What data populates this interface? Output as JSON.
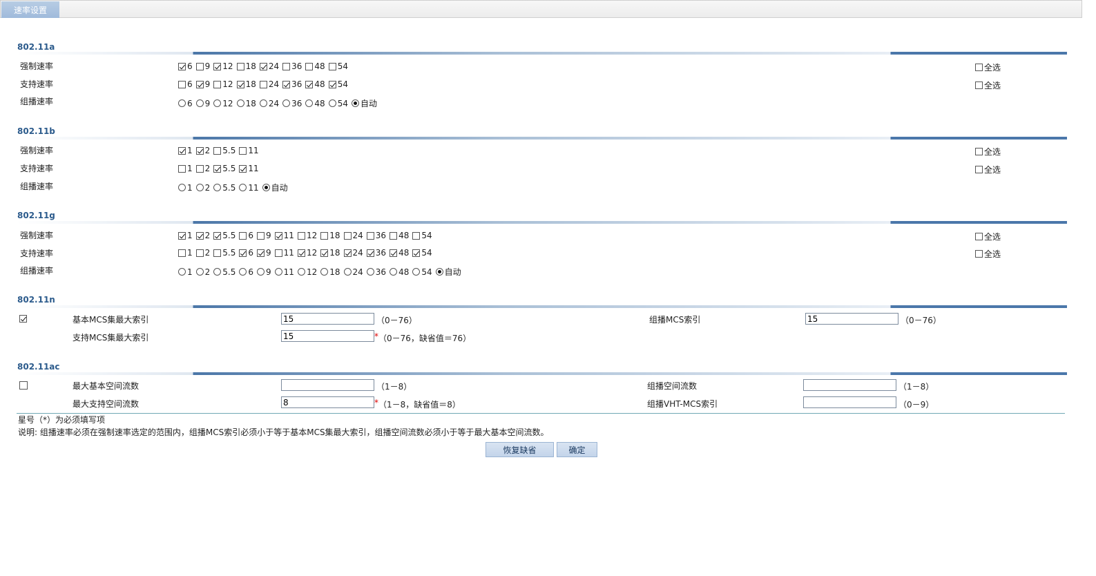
{
  "tab": {
    "label": "速率设置"
  },
  "common": {
    "mandatory": "强制速率",
    "supported": "支持速率",
    "multicast": "组播速率",
    "select_all": "全选",
    "auto": "自动"
  },
  "a": {
    "title": "802.11a",
    "rates": [
      "6",
      "9",
      "12",
      "18",
      "24",
      "36",
      "48",
      "54"
    ],
    "mandatory_checked": [
      true,
      false,
      true,
      false,
      true,
      false,
      false,
      false
    ],
    "supported_checked": [
      false,
      true,
      false,
      true,
      false,
      true,
      true,
      true
    ],
    "multicast_selected": "自动"
  },
  "b": {
    "title": "802.11b",
    "rates": [
      "1",
      "2",
      "5.5",
      "11"
    ],
    "mandatory_checked": [
      true,
      true,
      false,
      false
    ],
    "supported_checked": [
      false,
      false,
      true,
      true
    ],
    "multicast_selected": "自动"
  },
  "g": {
    "title": "802.11g",
    "rates": [
      "1",
      "2",
      "5.5",
      "6",
      "9",
      "11",
      "12",
      "18",
      "24",
      "36",
      "48",
      "54"
    ],
    "mandatory_checked": [
      true,
      true,
      true,
      false,
      false,
      true,
      false,
      false,
      false,
      false,
      false,
      false
    ],
    "supported_checked": [
      false,
      false,
      false,
      true,
      true,
      false,
      true,
      true,
      true,
      true,
      true,
      true
    ],
    "multicast_selected": "自动"
  },
  "n": {
    "title": "802.11n",
    "enabled": true,
    "basic_mcs_label": "基本MCS集最大索引",
    "basic_mcs_value": "15",
    "basic_mcs_hint": "（0－76）",
    "supported_mcs_label": "支持MCS集最大索引",
    "supported_mcs_value": "15",
    "required_mark": "*",
    "supported_mcs_hint": "（0－76，缺省值＝76）",
    "multicast_mcs_label": "组播MCS索引",
    "multicast_mcs_value": "15",
    "multicast_mcs_hint": "（0－76）"
  },
  "ac": {
    "title": "802.11ac",
    "enabled": false,
    "max_basic_nss_label": "最大基本空间流数",
    "max_basic_nss_value": "",
    "max_basic_nss_hint": "（1－8）",
    "max_supported_nss_label": "最大支持空间流数",
    "max_supported_nss_value": "8",
    "required_mark": "*",
    "max_supported_nss_hint": "（1－8，缺省值＝8）",
    "multicast_nss_label": "组播空间流数",
    "multicast_nss_value": "",
    "multicast_nss_hint": "（1－8）",
    "multicast_vht_label": "组播VHT-MCS索引",
    "multicast_vht_value": "",
    "multicast_vht_hint": "（0－9）"
  },
  "footer": {
    "required_note": "星号（*）为必须填写项",
    "explanation": "说明: 组播速率必须在强制速率选定的范围内，组播MCS索引必须小于等于基本MCS集最大索引，组播空间流数必须小于等于最大基本空间流数。",
    "restore_button": "恢复缺省",
    "ok_button": "确定"
  }
}
